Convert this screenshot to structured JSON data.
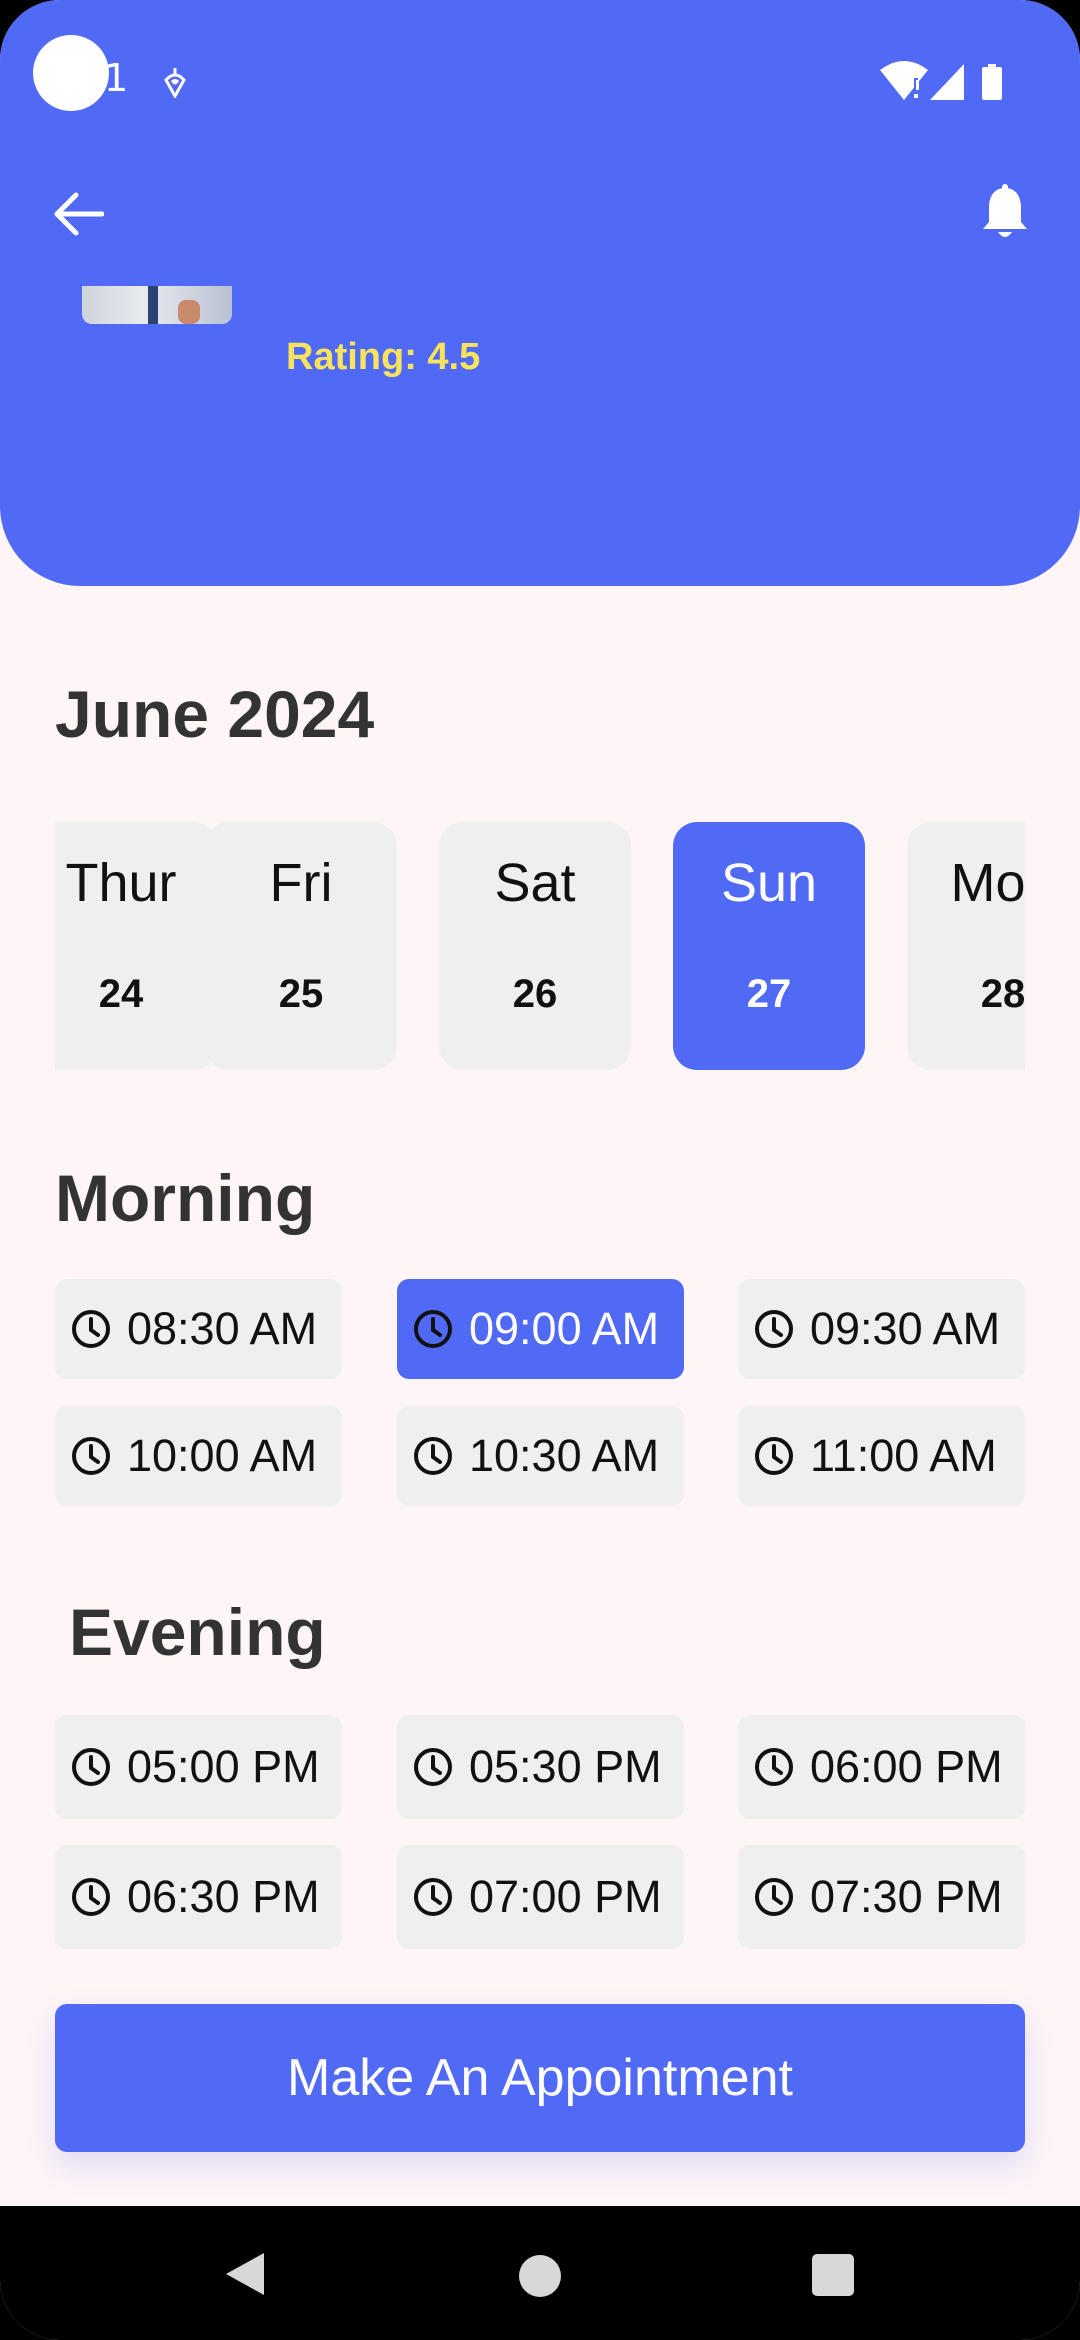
{
  "status_bar": {
    "clock_fragment": "1"
  },
  "header": {
    "rating_text": "Rating: 4.5"
  },
  "calendar": {
    "month": "June 2024",
    "days": [
      {
        "name": "Thur",
        "num": "24",
        "selected": false
      },
      {
        "name": "Fri",
        "num": "25",
        "selected": false
      },
      {
        "name": "Sat",
        "num": "26",
        "selected": false
      },
      {
        "name": "Sun",
        "num": "27",
        "selected": true
      },
      {
        "name": "Mon",
        "num": "28",
        "selected": false
      }
    ]
  },
  "morning": {
    "title": "Morning",
    "slots": [
      "08:30 AM",
      "09:00 AM",
      "09:30 AM",
      "10:00 AM",
      "10:30 AM",
      "11:00 AM"
    ],
    "selected": "09:00 AM"
  },
  "evening": {
    "title": "Evening",
    "slots": [
      "05:00 PM",
      "05:30 PM",
      "06:00 PM",
      "06:30 PM",
      "07:00 PM",
      "07:30 PM"
    ]
  },
  "cta": {
    "label": "Make An Appointment"
  },
  "colors": {
    "primary": "#516af6",
    "background": "#fef5f7",
    "card": "#efefef",
    "rating": "#f8e45c"
  }
}
